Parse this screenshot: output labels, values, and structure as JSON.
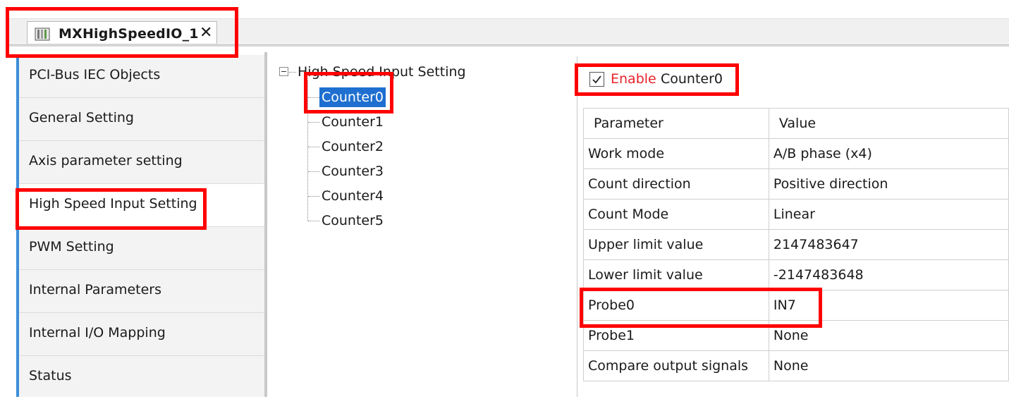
{
  "tab": {
    "title": "MXHighSpeedIO_1",
    "close_label": "✕",
    "icon": "device-module-icon"
  },
  "leftnav": {
    "items": [
      {
        "label": "PCI-Bus IEC Objects"
      },
      {
        "label": "General Setting"
      },
      {
        "label": "Axis parameter setting"
      },
      {
        "label": "High Speed Input Setting",
        "active": true
      },
      {
        "label": "PWM Setting"
      },
      {
        "label": "Internal Parameters"
      },
      {
        "label": "Internal I/O Mapping"
      },
      {
        "label": "Status"
      }
    ]
  },
  "tree": {
    "root_label": "High Speed Input Setting",
    "nodes": [
      {
        "label": "Counter0",
        "selected": true
      },
      {
        "label": "Counter1"
      },
      {
        "label": "Counter2"
      },
      {
        "label": "Counter3"
      },
      {
        "label": "Counter4"
      },
      {
        "label": "Counter5"
      }
    ]
  },
  "enable": {
    "checked": true,
    "label": "Enable",
    "counter_name": "Counter0"
  },
  "table": {
    "headers": [
      "Parameter",
      "Value"
    ],
    "rows": [
      {
        "param": "Work mode",
        "value": "A/B phase (x4)"
      },
      {
        "param": "Count direction",
        "value": "Positive direction"
      },
      {
        "param": "Count Mode",
        "value": "Linear"
      },
      {
        "param": "Upper limit value",
        "value": "2147483647"
      },
      {
        "param": "Lower limit value",
        "value": "-2147483648"
      },
      {
        "param": "Probe0",
        "value": "IN7"
      },
      {
        "param": "Probe1",
        "value": "None"
      },
      {
        "param": "Compare output signals",
        "value": "None"
      }
    ]
  },
  "colors": {
    "highlight": "#ff0000",
    "selection": "#1e6fd0",
    "nav_accent": "#3c8fd8",
    "enable_text": "#e8222a"
  }
}
